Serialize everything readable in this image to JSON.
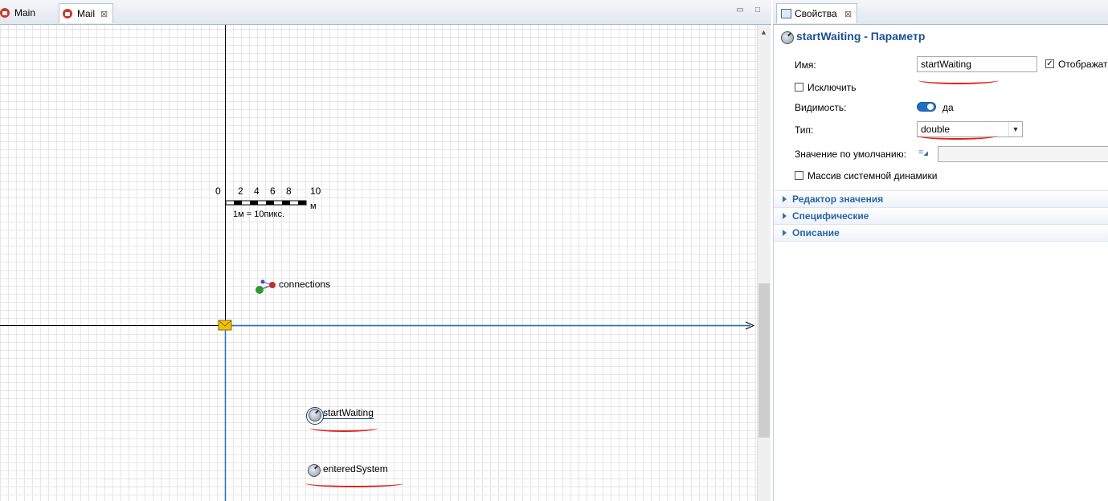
{
  "editor": {
    "tabs": [
      {
        "label": "Main"
      },
      {
        "label": "Mail"
      }
    ],
    "close_glyph": "⊠",
    "minimize_glyph": "▭",
    "maximize_glyph": "□"
  },
  "canvas": {
    "scale": {
      "ticks": [
        "0",
        "2",
        "4",
        "6",
        "8",
        "10"
      ],
      "unit": "м",
      "caption": "1м = 10пикс."
    },
    "connections_label": "connections",
    "parameters": [
      {
        "label": "startWaiting",
        "selected": true
      },
      {
        "label": "enteredSystem",
        "selected": false
      }
    ]
  },
  "properties": {
    "tab_label": "Свойства",
    "title": "startWaiting - Параметр",
    "name_label": "Имя:",
    "name_value": "startWaiting",
    "show_name_label": "Отображать",
    "exclude_label": "Исключить",
    "visibility_label": "Видимость:",
    "visibility_value": "да",
    "type_label": "Тип:",
    "type_value": "double",
    "default_label": "Значение по умолчанию:",
    "sd_array_label": "Массив системной динамики",
    "sections": [
      "Редактор значения",
      "Специфические",
      "Описание"
    ]
  },
  "colors": {
    "accent": "#1d4f8f",
    "section_text": "#2a64a8",
    "annotation_red": "#e0201a",
    "axis_blue": "#1f6fbf",
    "envelope": "#f2c200"
  }
}
